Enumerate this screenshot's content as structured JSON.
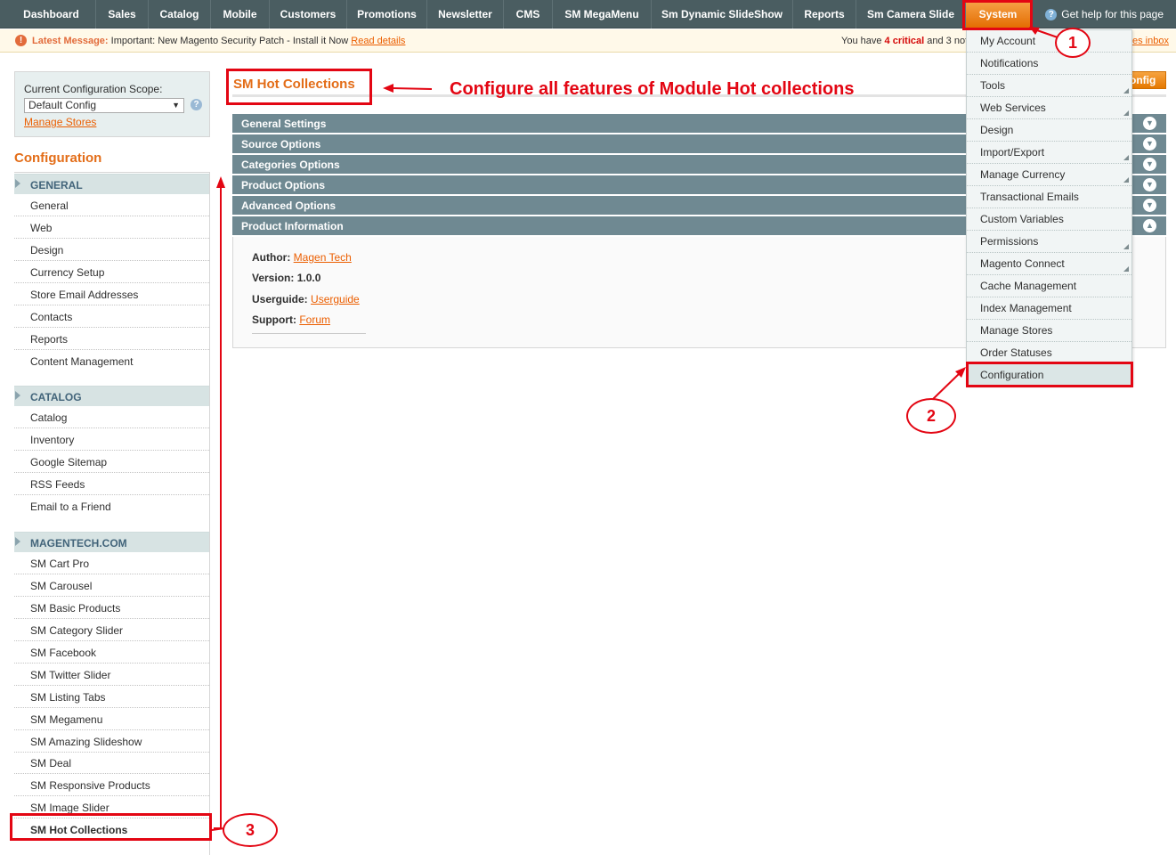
{
  "nav": {
    "items": [
      "Dashboard",
      "Sales",
      "Catalog",
      "Mobile",
      "Customers",
      "Promotions",
      "Newsletter",
      "CMS",
      "SM MegaMenu",
      "Sm Dynamic SlideShow",
      "Reports",
      "Sm Camera Slide",
      "System"
    ],
    "active": "System",
    "help": "Get help for this page"
  },
  "message": {
    "label": "Latest Message:",
    "text": "Important: New Magento Security Patch - Install it Now",
    "link": "Read details",
    "right_prefix": "You have",
    "critical_count": "4 critical",
    "right_mid": "and 3 noti",
    "inbox_tail": "es inbox"
  },
  "scope": {
    "label": "Current Configuration Scope:",
    "selected": "Default Config",
    "manage_link": "Manage Stores"
  },
  "sidebar": {
    "title": "Configuration",
    "sections": [
      {
        "title": "GENERAL",
        "items": [
          "General",
          "Web",
          "Design",
          "Currency Setup",
          "Store Email Addresses",
          "Contacts",
          "Reports",
          "Content Management"
        ]
      },
      {
        "title": "CATALOG",
        "items": [
          "Catalog",
          "Inventory",
          "Google Sitemap",
          "RSS Feeds",
          "Email to a Friend"
        ]
      },
      {
        "title": "MAGENTECH.COM",
        "items": [
          "SM Cart Pro",
          "SM Carousel",
          "SM Basic Products",
          "SM Category Slider",
          "SM Facebook",
          "SM Twitter Slider",
          "SM Listing Tabs",
          "SM Megamenu",
          "SM Amazing Slideshow",
          "SM Deal",
          "SM Responsive Products",
          "SM Image Slider",
          "SM Hot Collections"
        ]
      }
    ],
    "active_item": "SM Hot Collections"
  },
  "main": {
    "title": "SM Hot Collections",
    "save_label": "onfig",
    "sections": [
      "General Settings",
      "Source Options",
      "Categories Options",
      "Product Options",
      "Advanced Options",
      "Product Information"
    ],
    "info": {
      "author_label": "Author:",
      "author_value": "Magen Tech",
      "version_label": "Version:",
      "version_value": "1.0.0",
      "guide_label": "Userguide:",
      "guide_value": "Userguide",
      "support_label": "Support:",
      "support_value": "Forum"
    }
  },
  "system_menu": {
    "items": [
      "My Account",
      "Notifications",
      "Tools",
      "Web Services",
      "Design",
      "Import/Export",
      "Manage Currency",
      "Transactional Emails",
      "Custom Variables",
      "Permissions",
      "Magento Connect",
      "Cache Management",
      "Index Management",
      "Manage Stores",
      "Order Statuses",
      "Configuration"
    ],
    "with_submenu": [
      "Tools",
      "Web Services",
      "Import/Export",
      "Manage Currency",
      "Permissions",
      "Magento Connect"
    ],
    "selected": "Configuration"
  },
  "annotations": {
    "callout": "Configure all features of Module Hot collections",
    "step1": "1",
    "step2": "2",
    "step3": "3"
  }
}
